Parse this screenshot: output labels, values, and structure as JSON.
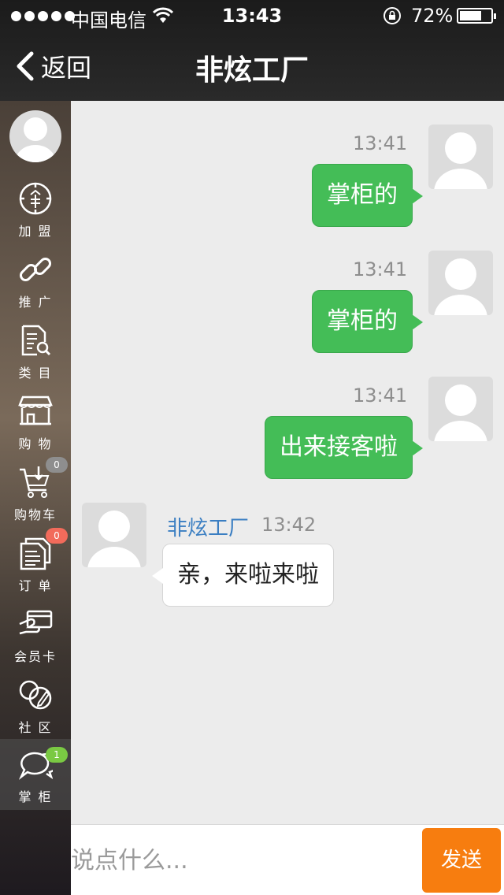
{
  "status_bar": {
    "carrier": "中国电信",
    "time": "13:43",
    "battery_percent": "72%",
    "battery_level": 0.72
  },
  "nav": {
    "back_label": "返回",
    "title": "非炫工厂"
  },
  "sidebar": {
    "items": [
      {
        "label": "加 盟",
        "icon": "coin-circle-icon"
      },
      {
        "label": "推 广",
        "icon": "link-icon"
      },
      {
        "label": "类 目",
        "icon": "document-search-icon"
      },
      {
        "label": "购 物",
        "icon": "storefront-icon"
      },
      {
        "label": "购物车",
        "icon": "cart-icon",
        "badge": "0",
        "badge_color": "#8e8e8e"
      },
      {
        "label": "订 单",
        "icon": "orders-icon",
        "badge": "0",
        "badge_color": "#f26b5b"
      },
      {
        "label": "会员卡",
        "icon": "member-card-icon"
      },
      {
        "label": "社 区",
        "icon": "community-icon"
      },
      {
        "label": "掌 柜",
        "icon": "chat-bubbles-icon",
        "badge": "1",
        "badge_color": "#7ac943",
        "active": true
      }
    ]
  },
  "messages": [
    {
      "direction": "out",
      "time": "13:41",
      "text": "掌柜的"
    },
    {
      "direction": "out",
      "time": "13:41",
      "text": "掌柜的"
    },
    {
      "direction": "out",
      "time": "13:41",
      "text": "出来接客啦"
    },
    {
      "direction": "in",
      "sender": "非炫工厂",
      "time": "13:42",
      "text": "亲，来啦来啦"
    }
  ],
  "input": {
    "placeholder": "说点什么...",
    "value": "",
    "send_label": "发送"
  },
  "colors": {
    "outgoing_bubble": "#44bd57",
    "send_button": "#f77d0f",
    "sender_name": "#3a7ec2"
  }
}
